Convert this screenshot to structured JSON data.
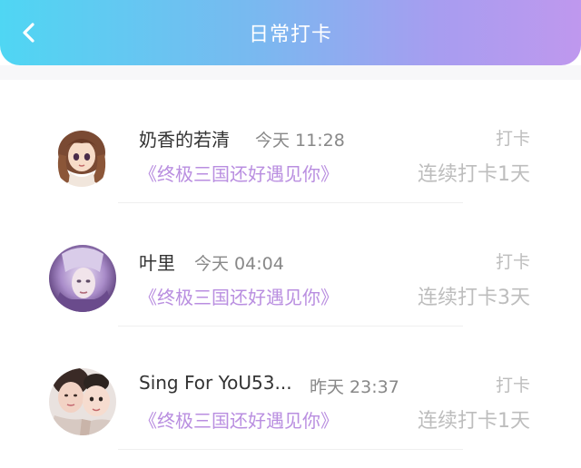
{
  "header": {
    "title": "日常打卡",
    "back_icon": "chevron-left-icon",
    "gradient_colors": [
      "#4fd6f3",
      "#a79df0",
      "#bf98ee"
    ]
  },
  "entries": [
    {
      "name": "奶香的若清",
      "time": "今天 11:28",
      "group": "《终极三国还好遇见你》",
      "checkin_label": "打卡",
      "streak": "连续打卡1天",
      "avatar": "avatar-anime-girl"
    },
    {
      "name": "叶里",
      "time": "今天 04:04",
      "group": "《终极三国还好遇见你》",
      "checkin_label": "打卡",
      "streak": "连续打卡3天",
      "avatar": "avatar-purple-portrait"
    },
    {
      "name": "Sing For YoU53...",
      "time": "昨天 23:37",
      "group": "《终极三国还好遇见你》",
      "checkin_label": "打卡",
      "streak": "连续打卡1天",
      "avatar": "avatar-mother-child-photo"
    }
  ],
  "colors": {
    "group_text": "#b98ee0",
    "muted_text": "#bdbdbd",
    "name_text": "#333333"
  }
}
